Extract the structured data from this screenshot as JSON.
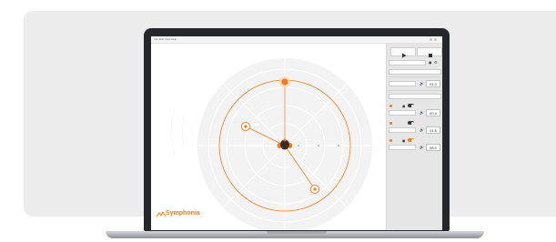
{
  "app": {
    "brand_name": "Symphonia",
    "menu": [
      "File",
      "Edit",
      "View",
      "Help"
    ]
  },
  "colors": {
    "accent": "#ee7d1a",
    "background": "#ececec",
    "bezel": "#26272a",
    "panel": "#e6e6e6"
  },
  "icons": {
    "play": "play-icon",
    "stop": "stop-icon",
    "speaker": "speaker-icon",
    "lock": "lock-icon",
    "settings": "gear-icon",
    "brand": "symphonia-logo-icon"
  },
  "sources": [
    {
      "value": "01.0"
    },
    {
      "value": "00.4"
    },
    {
      "value": "01.6"
    },
    {
      "value": "08.0"
    }
  ]
}
